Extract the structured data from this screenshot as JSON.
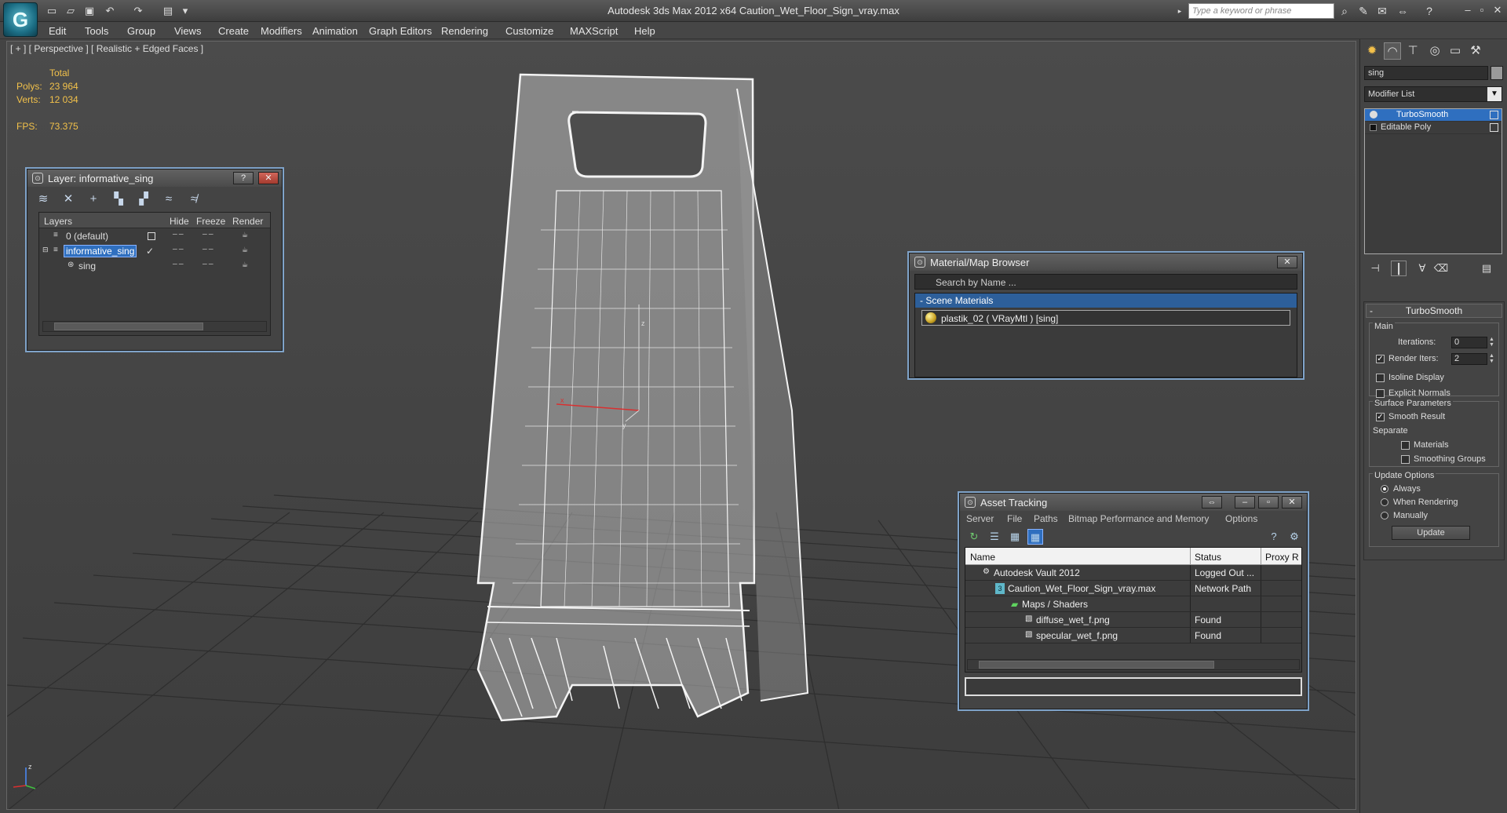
{
  "app": {
    "title": "Autodesk 3ds Max  2012 x64      Caution_Wet_Floor_Sign_vray.max",
    "search_placeholder": "Type a keyword or phrase"
  },
  "menu": [
    "Edit",
    "Tools",
    "Group",
    "Views",
    "Create",
    "Modifiers",
    "Animation",
    "Graph Editors",
    "Rendering",
    "Customize",
    "MAXScript",
    "Help"
  ],
  "viewport": {
    "label": "[ + ] [ Perspective ] [ Realistic + Edged Faces ]",
    "stats_header": "Total",
    "polys_label": "Polys:",
    "polys": "23 964",
    "verts_label": "Verts:",
    "verts": "12 034",
    "fps_label": "FPS:",
    "fps": "73.375"
  },
  "layer_window": {
    "title": "Layer: informative_sing",
    "columns": {
      "layers": "Layers",
      "hide": "Hide",
      "freeze": "Freeze",
      "render": "Render"
    },
    "rows": [
      {
        "name": "0 (default)"
      },
      {
        "name": "informative_sing"
      },
      {
        "name": "sing"
      }
    ]
  },
  "material_browser": {
    "title": "Material/Map Browser",
    "search_placeholder": "Search by Name ...",
    "group": "- Scene Materials",
    "item": "plastik_02  ( VRayMtl ) [sing]"
  },
  "asset_tracking": {
    "title": "Asset Tracking",
    "menu": [
      "Server",
      "File",
      "Paths",
      "Bitmap Performance and Memory",
      "Options"
    ],
    "columns": {
      "name": "Name",
      "status": "Status",
      "proxy": "Proxy R"
    },
    "rows": [
      {
        "name": "Autodesk Vault 2012",
        "status": "Logged Out ..."
      },
      {
        "name": "Caution_Wet_Floor_Sign_vray.max",
        "status": "Network Path"
      },
      {
        "name": "Maps / Shaders",
        "status": ""
      },
      {
        "name": "diffuse_wet_f.png",
        "status": "Found"
      },
      {
        "name": "specular_wet_f.png",
        "status": "Found"
      }
    ]
  },
  "command_panel": {
    "object_name": "sing",
    "modifier_list": "Modifier List",
    "stack": [
      "TurboSmooth",
      "Editable Poly"
    ],
    "rollout_title": "TurboSmooth",
    "main_label": "Main",
    "iterations_label": "Iterations:",
    "iterations": "0",
    "render_iters_label": "Render Iters:",
    "render_iters": "2",
    "isoline": "Isoline Display",
    "explicit_normals": "Explicit Normals",
    "surface_params": "Surface Parameters",
    "smooth_result": "Smooth Result",
    "separate": "Separate",
    "materials": "Materials",
    "smoothing_groups": "Smoothing Groups",
    "update_options": "Update Options",
    "always": "Always",
    "when_rendering": "When Rendering",
    "manually": "Manually",
    "update_button": "Update"
  }
}
